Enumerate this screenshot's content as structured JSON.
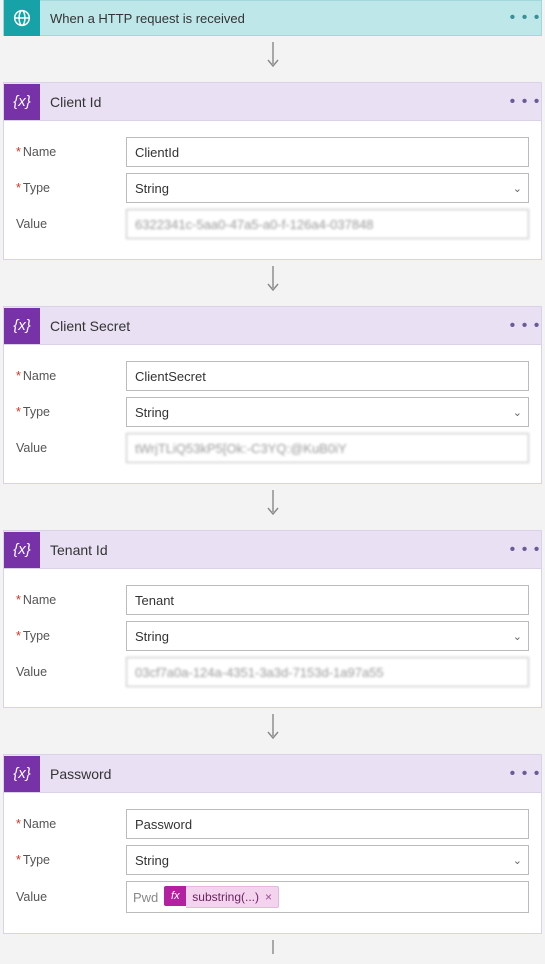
{
  "trigger": {
    "title": "When a HTTP request is received",
    "icon": "http-request-icon"
  },
  "actions": [
    {
      "title": "Client Id",
      "fields": {
        "name_label": "Name",
        "name_value": "ClientId",
        "type_label": "Type",
        "type_value": "String",
        "value_label": "Value",
        "value_text": "6322341c-5aa0-47a5-a0-f-126a4-037848",
        "value_blurred": true
      }
    },
    {
      "title": "Client Secret",
      "fields": {
        "name_label": "Name",
        "name_value": "ClientSecret",
        "type_label": "Type",
        "type_value": "String",
        "value_label": "Value",
        "value_text": "tWrjTLiQ53kP5[Ok:-C3YQ:@KuB0iY",
        "value_blurred": true
      }
    },
    {
      "title": "Tenant Id",
      "fields": {
        "name_label": "Name",
        "name_value": "Tenant",
        "type_label": "Type",
        "type_value": "String",
        "value_label": "Value",
        "value_text": "03cf7a0a-124a-4351-3a3d-7153d-1a97a55",
        "value_blurred": true
      }
    },
    {
      "title": "Password",
      "fields": {
        "name_label": "Name",
        "name_value": "Password",
        "type_label": "Type",
        "type_value": "String",
        "value_label": "Value",
        "value_token_prefix": "Pwd",
        "value_fx": "fx",
        "value_chip": "substring(...)"
      }
    }
  ],
  "icons": {
    "variable": "{x}",
    "ellipsis": "• • •"
  }
}
